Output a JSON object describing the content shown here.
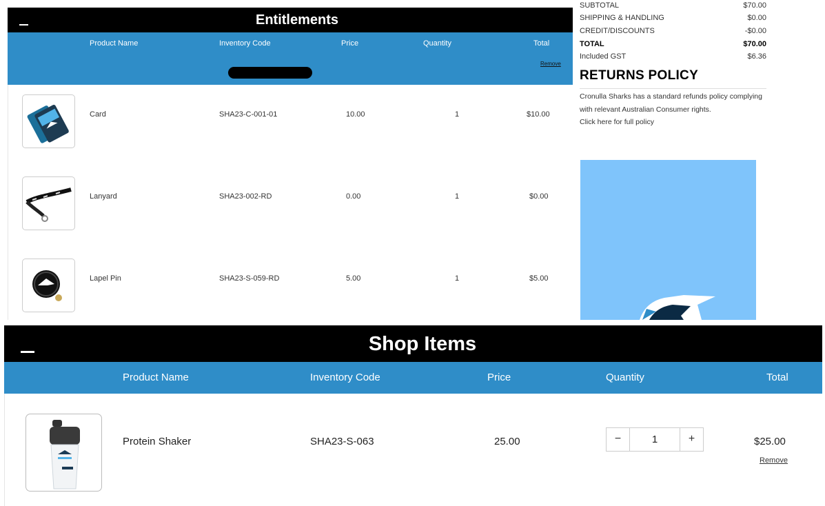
{
  "entitlements": {
    "title": "Entitlements",
    "columns": {
      "product": "Product Name",
      "inventory": "Inventory Code",
      "price": "Price",
      "quantity": "Quantity",
      "total": "Total"
    },
    "remove_label": "Remove",
    "rows": [
      {
        "name": "Card",
        "code": "SHA23-C-001-01",
        "price": "10.00",
        "qty": "1",
        "total": "$10.00"
      },
      {
        "name": "Lanyard",
        "code": "SHA23-002-RD",
        "price": "0.00",
        "qty": "1",
        "total": "$0.00"
      },
      {
        "name": "Lapel Pin",
        "code": "SHA23-S-059-RD",
        "price": "5.00",
        "qty": "1",
        "total": "$5.00"
      }
    ]
  },
  "summary": {
    "lines": [
      {
        "label": "SUBTOTAL",
        "value": "$70.00"
      },
      {
        "label": "SHIPPING & HANDLING",
        "value": "$0.00"
      },
      {
        "label": "CREDIT/DISCOUNTS",
        "value": "-$0.00"
      },
      {
        "label": "TOTAL",
        "value": "$70.00"
      },
      {
        "label": "Included GST",
        "value": "$6.36"
      }
    ]
  },
  "returns": {
    "title": "RETURNS POLICY",
    "text1": "Cronulla Sharks has a standard refunds policy complying with relevant Australian Consumer rights.",
    "link": "Click here for full policy"
  },
  "shop": {
    "title": "Shop Items",
    "columns": {
      "product": "Product Name",
      "inventory": "Inventory Code",
      "price": "Price",
      "quantity": "Quantity",
      "total": "Total"
    },
    "item": {
      "name": "Protein Shaker",
      "code": "SHA23-S-063",
      "price": "25.00",
      "qty": "1",
      "total": "$25.00",
      "remove": "Remove"
    },
    "minus": "−",
    "plus": "+"
  },
  "colors": {
    "header_blue": "#2f8dc8",
    "banner_blue": "#7fc4fb",
    "bar_black": "#000000"
  }
}
